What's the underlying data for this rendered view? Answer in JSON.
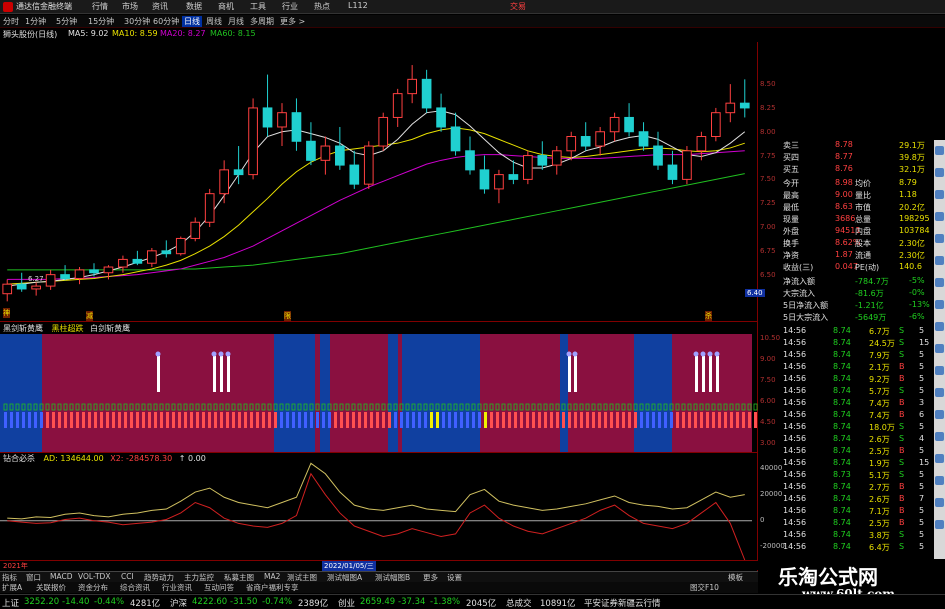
{
  "app": {
    "title": "通达信金融终端",
    "trade_label": "交易",
    "hotkey_label": "L112"
  },
  "menu": [
    "行情",
    "市场",
    "资讯",
    "数据",
    "商机",
    "工具",
    "行业",
    "热点"
  ],
  "periods": [
    {
      "label": "分时",
      "active": false
    },
    {
      "label": "1分钟",
      "active": false
    },
    {
      "label": "5分钟",
      "active": false
    },
    {
      "label": "15分钟",
      "active": false
    },
    {
      "label": "30分钟",
      "active": false
    },
    {
      "label": "60分钟",
      "active": false
    },
    {
      "label": "日线",
      "active": true
    },
    {
      "label": "周线",
      "active": false
    },
    {
      "label": "月线",
      "active": false
    },
    {
      "label": "多周期",
      "active": false
    },
    {
      "label": "更多 >",
      "active": false
    }
  ],
  "stock_info": {
    "name": "狮头股份(日线)",
    "ma5": "MA5: 9.02",
    "ma10": "MA10: 8.59",
    "ma20": "MA20: 8.27",
    "ma60": "MA60: 8.15"
  },
  "colors": {
    "up": "#ff4040",
    "down": "#20d0d0",
    "ma5": "#e0e0e0",
    "ma10": "#e8e000",
    "ma20": "#d000d0",
    "ma60": "#20c020",
    "panel_sep": "#800000"
  },
  "main_chart": {
    "low_label": "6.27",
    "price_ticks": [
      "8.50",
      "8.25",
      "8.00",
      "7.75",
      "7.50",
      "7.25",
      "7.00",
      "6.75",
      "6.50"
    ],
    "current_price_tag": "6.40",
    "markers": [
      "神",
      "减",
      "限",
      "杀"
    ],
    "candles": [
      [
        6.3,
        6.45,
        6.22,
        6.4
      ],
      [
        6.4,
        6.52,
        6.32,
        6.35
      ],
      [
        6.35,
        6.42,
        6.28,
        6.38
      ],
      [
        6.38,
        6.55,
        6.34,
        6.5
      ],
      [
        6.5,
        6.6,
        6.44,
        6.46
      ],
      [
        6.46,
        6.58,
        6.4,
        6.55
      ],
      [
        6.55,
        6.62,
        6.48,
        6.52
      ],
      [
        6.52,
        6.6,
        6.45,
        6.58
      ],
      [
        6.58,
        6.7,
        6.52,
        6.66
      ],
      [
        6.66,
        6.75,
        6.6,
        6.62
      ],
      [
        6.62,
        6.78,
        6.58,
        6.75
      ],
      [
        6.75,
        6.86,
        6.68,
        6.72
      ],
      [
        6.72,
        6.9,
        6.7,
        6.88
      ],
      [
        6.88,
        7.1,
        6.85,
        7.05
      ],
      [
        7.05,
        7.4,
        7.0,
        7.35
      ],
      [
        7.35,
        7.7,
        7.25,
        7.6
      ],
      [
        7.6,
        7.85,
        7.45,
        7.55
      ],
      [
        7.55,
        8.35,
        7.5,
        8.25
      ],
      [
        8.25,
        8.6,
        7.95,
        8.05
      ],
      [
        8.05,
        8.3,
        7.85,
        8.2
      ],
      [
        8.2,
        8.35,
        7.8,
        7.9
      ],
      [
        7.9,
        8.1,
        7.65,
        7.7
      ],
      [
        7.7,
        7.95,
        7.55,
        7.85
      ],
      [
        7.85,
        8.05,
        7.6,
        7.65
      ],
      [
        7.65,
        7.8,
        7.4,
        7.45
      ],
      [
        7.45,
        7.9,
        7.4,
        7.85
      ],
      [
        7.85,
        8.2,
        7.8,
        8.15
      ],
      [
        8.15,
        8.45,
        8.05,
        8.4
      ],
      [
        8.4,
        8.7,
        8.3,
        8.55
      ],
      [
        8.55,
        8.65,
        8.2,
        8.25
      ],
      [
        8.25,
        8.4,
        8.0,
        8.05
      ],
      [
        8.05,
        8.2,
        7.75,
        7.8
      ],
      [
        7.8,
        7.95,
        7.55,
        7.6
      ],
      [
        7.6,
        7.75,
        7.35,
        7.4
      ],
      [
        7.4,
        7.6,
        7.25,
        7.55
      ],
      [
        7.55,
        7.7,
        7.45,
        7.5
      ],
      [
        7.5,
        7.8,
        7.45,
        7.75
      ],
      [
        7.75,
        7.9,
        7.6,
        7.65
      ],
      [
        7.65,
        7.85,
        7.55,
        7.8
      ],
      [
        7.8,
        8.0,
        7.7,
        7.95
      ],
      [
        7.95,
        8.1,
        7.8,
        7.85
      ],
      [
        7.85,
        8.05,
        7.75,
        8.0
      ],
      [
        8.0,
        8.2,
        7.9,
        8.15
      ],
      [
        8.15,
        8.3,
        7.95,
        8.0
      ],
      [
        8.0,
        8.1,
        7.8,
        7.85
      ],
      [
        7.85,
        8.0,
        7.6,
        7.65
      ],
      [
        7.65,
        7.8,
        7.45,
        7.5
      ],
      [
        7.5,
        7.85,
        7.45,
        7.8
      ],
      [
        7.8,
        8.0,
        7.7,
        7.95
      ],
      [
        7.95,
        8.25,
        7.9,
        8.2
      ],
      [
        8.2,
        8.5,
        8.1,
        8.3
      ],
      [
        8.3,
        8.55,
        8.15,
        8.25
      ]
    ],
    "ma5": [
      6.38,
      6.4,
      6.42,
      6.43,
      6.45,
      6.47,
      6.5,
      6.54,
      6.58,
      6.63,
      6.68,
      6.74,
      6.82,
      6.95,
      7.12,
      7.33,
      7.55,
      7.78,
      7.95,
      8.0,
      8.02,
      7.98,
      7.94,
      7.88,
      7.78,
      7.75,
      7.8,
      7.92,
      8.08,
      8.2,
      8.22,
      8.18,
      8.06,
      7.92,
      7.78,
      7.68,
      7.62,
      7.62,
      7.66,
      7.72,
      7.8,
      7.84,
      7.9,
      7.94,
      7.96,
      7.92,
      7.84,
      7.76,
      7.74,
      7.78,
      7.88,
      8.0
    ],
    "ma10": [
      6.4,
      6.41,
      6.42,
      6.43,
      6.44,
      6.45,
      6.46,
      6.48,
      6.5,
      6.53,
      6.56,
      6.6,
      6.65,
      6.72,
      6.8,
      6.9,
      7.02,
      7.16,
      7.3,
      7.45,
      7.58,
      7.68,
      7.75,
      7.8,
      7.82,
      7.84,
      7.86,
      7.88,
      7.92,
      7.98,
      8.02,
      8.04,
      8.02,
      7.98,
      7.92,
      7.86,
      7.8,
      7.76,
      7.74,
      7.73,
      7.74,
      7.76,
      7.78,
      7.8,
      7.82,
      7.83,
      7.82,
      7.8,
      7.79,
      7.8,
      7.83,
      7.88
    ],
    "ma20": [
      6.45,
      6.45,
      6.45,
      6.45,
      6.46,
      6.46,
      6.47,
      6.48,
      6.49,
      6.5,
      6.52,
      6.54,
      6.56,
      6.6,
      6.64,
      6.68,
      6.74,
      6.8,
      6.88,
      6.96,
      7.04,
      7.12,
      7.2,
      7.28,
      7.35,
      7.42,
      7.48,
      7.54,
      7.6,
      7.66,
      7.7,
      7.73,
      7.75,
      7.76,
      7.76,
      7.75,
      7.74,
      7.73,
      7.72,
      7.72,
      7.72,
      7.72,
      7.73,
      7.74,
      7.75,
      7.76,
      7.76,
      7.76,
      7.77,
      7.78,
      7.79,
      7.8
    ],
    "ma60": [
      6.55,
      6.55,
      6.55,
      6.55,
      6.55,
      6.55,
      6.55,
      6.55,
      6.55,
      6.55,
      6.55,
      6.55,
      6.56,
      6.56,
      6.57,
      6.58,
      6.59,
      6.6,
      6.62,
      6.64,
      6.66,
      6.68,
      6.7,
      6.72,
      6.75,
      6.78,
      6.81,
      6.84,
      6.87,
      6.9,
      6.93,
      6.96,
      6.99,
      7.02,
      7.05,
      7.08,
      7.11,
      7.14,
      7.17,
      7.2,
      7.23,
      7.26,
      7.29,
      7.32,
      7.35,
      7.38,
      7.41,
      7.44,
      7.47,
      7.5,
      7.53,
      7.56
    ]
  },
  "indicator1": {
    "name": "黑剑斩黄鹰",
    "tag": "黑柱超跌",
    "tag2": "白剑斩黄鹰",
    "ticks": [
      "10.50",
      "9.00",
      "7.50",
      "6.00",
      "4.50",
      "3.00"
    ]
  },
  "indicator2": {
    "name": "钻合必杀",
    "ad": "AD: 134644.00",
    "x2": "X2: -284578.30",
    "x3": "↑ 0.00",
    "ticks": [
      "40000",
      "20000",
      "0",
      "-20000"
    ]
  },
  "timeline": {
    "left_label": "2021年",
    "date": "2022/01/05/三"
  },
  "right_panel": {
    "orderbook": [
      {
        "label": "卖三",
        "price": "8.78",
        "vol": "29.1万"
      },
      {
        "label": "买四",
        "price": "8.77",
        "vol": "39.8万"
      },
      {
        "label": "买五",
        "price": "8.76",
        "vol": "32.1万"
      }
    ],
    "stats": [
      {
        "l1": "今开",
        "v1": "8.98",
        "l2": "均价",
        "v2": "8.79"
      },
      {
        "l1": "最高",
        "v1": "9.00",
        "l2": "量比",
        "v2": "1.18"
      },
      {
        "l1": "最低",
        "v1": "8.63",
        "l2": "市值",
        "v2": "20.2亿"
      },
      {
        "l1": "现量",
        "v1": "3686",
        "l2": "总量",
        "v2": "198295"
      },
      {
        "l1": "外盘",
        "v1": "94511",
        "l2": "内盘",
        "v2": "103784"
      },
      {
        "l1": "换手",
        "v1": "8.62%",
        "l2": "股本",
        "v2": "2.30亿"
      },
      {
        "l1": "净资",
        "v1": "1.87",
        "l2": "流通",
        "v2": "2.30亿"
      },
      {
        "l1": "收益(三)",
        "v1": "0.047",
        "l2": "PE(动)",
        "v2": "140.6"
      }
    ],
    "flows": [
      {
        "label": "净流入额",
        "value": "-784.7万",
        "pct": "-5%"
      },
      {
        "label": "大宗流入",
        "value": "-81.6万",
        "pct": "-0%"
      },
      {
        "label": "5日净流入额",
        "value": "-1.21亿",
        "pct": "-13%"
      },
      {
        "label": "5日大宗流入",
        "value": "-5649万",
        "pct": "-6%"
      }
    ],
    "ticks": [
      {
        "time": "14:56",
        "price": "8.74",
        "vol": "6.7万",
        "bs": "S",
        "n": "5"
      },
      {
        "time": "14:56",
        "price": "8.74",
        "vol": "24.5万",
        "bs": "S",
        "n": "15"
      },
      {
        "time": "14:56",
        "price": "8.74",
        "vol": "7.9万",
        "bs": "S",
        "n": "5"
      },
      {
        "time": "14:56",
        "price": "8.74",
        "vol": "2.1万",
        "bs": "B",
        "n": "5"
      },
      {
        "time": "14:56",
        "price": "8.74",
        "vol": "9.2万",
        "bs": "B",
        "n": "5"
      },
      {
        "time": "14:56",
        "price": "8.74",
        "vol": "5.7万",
        "bs": "S",
        "n": "5"
      },
      {
        "time": "14:56",
        "price": "8.74",
        "vol": "7.4万",
        "bs": "B",
        "n": "3"
      },
      {
        "time": "14:56",
        "price": "8.74",
        "vol": "7.4万",
        "bs": "B",
        "n": "6"
      },
      {
        "time": "14:56",
        "price": "8.74",
        "vol": "18.0万",
        "bs": "S",
        "n": "5"
      },
      {
        "time": "14:56",
        "price": "8.74",
        "vol": "2.6万",
        "bs": "S",
        "n": "4"
      },
      {
        "time": "14:56",
        "price": "8.74",
        "vol": "2.5万",
        "bs": "B",
        "n": "5"
      },
      {
        "time": "14:56",
        "price": "8.74",
        "vol": "1.9万",
        "bs": "S",
        "n": "15"
      },
      {
        "time": "14:56",
        "price": "8.73",
        "vol": "5.1万",
        "bs": "S",
        "n": "5"
      },
      {
        "time": "14:56",
        "price": "8.74",
        "vol": "2.7万",
        "bs": "B",
        "n": "5"
      },
      {
        "time": "14:56",
        "price": "8.74",
        "vol": "2.6万",
        "bs": "B",
        "n": "7"
      },
      {
        "time": "14:56",
        "price": "8.74",
        "vol": "7.1万",
        "bs": "B",
        "n": "5"
      },
      {
        "time": "14:56",
        "price": "8.74",
        "vol": "2.5万",
        "bs": "B",
        "n": "5"
      },
      {
        "time": "14:56",
        "price": "8.74",
        "vol": "3.8万",
        "bs": "S",
        "n": "5"
      },
      {
        "time": "14:56",
        "price": "8.74",
        "vol": "6.4万",
        "bs": "S",
        "n": "5"
      }
    ]
  },
  "tabs": [
    "指标",
    "窗口",
    "MACD",
    "VOL-TDX",
    "CCI",
    "趋势动力",
    "主力监控",
    "私募主图",
    "MA2",
    "测试主图",
    "测试幅图A",
    "测试幅图B",
    "更多",
    "设置"
  ],
  "ext_tabs": [
    "扩展A",
    "关联报价",
    "资金分布",
    "综合资讯",
    "行业资讯",
    "互动问答",
    "省商户福利专享"
  ],
  "ext_right": [
    "图交F10",
    "模板"
  ],
  "status": {
    "items": [
      {
        "name": "上证",
        "value": "3252.20",
        "chg": "-14.40",
        "pct": "-0.44%",
        "amt": "4281亿"
      },
      {
        "name": "沪深",
        "value": "4222.60",
        "chg": "-31.50",
        "pct": "-0.74%",
        "amt": "2389亿"
      },
      {
        "name": "创业",
        "value": "2659.49",
        "chg": "-37.34",
        "pct": "-1.38%",
        "amt": "2045亿"
      }
    ],
    "total_label": "总成交",
    "total": "10891亿",
    "broker": "平安证券新疆云行情"
  },
  "brand": {
    "line1": "乐淘公式网",
    "line2": "www.60lt.com"
  }
}
